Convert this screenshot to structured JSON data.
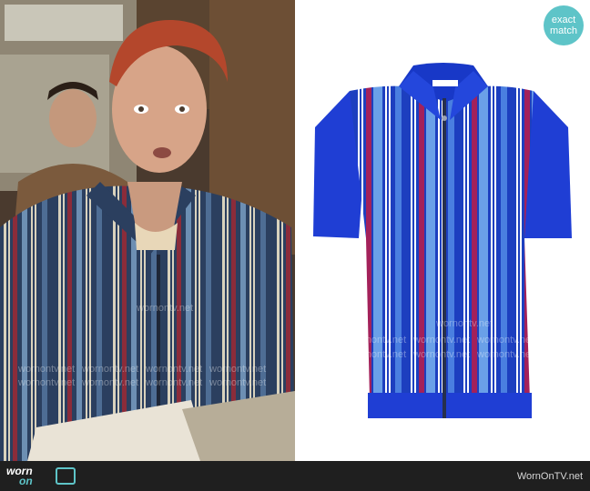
{
  "badge": {
    "line1": "exact",
    "line2": "match"
  },
  "watermark": "wornontv.net",
  "footer": {
    "logo_word1": "worn",
    "logo_word2": "on",
    "site": "WornOnTV.net"
  }
}
